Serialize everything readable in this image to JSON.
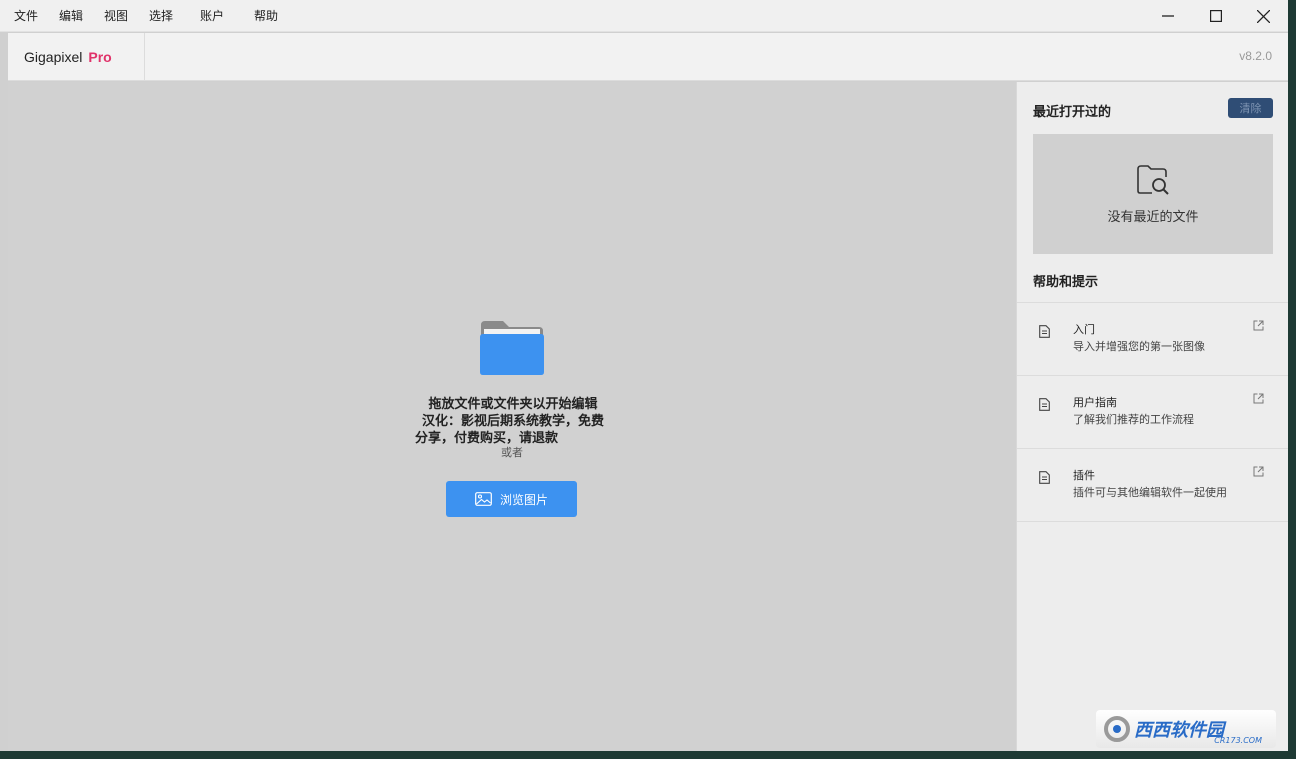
{
  "menu": {
    "items": [
      "文件",
      "编辑",
      "视图",
      "选择",
      "账户",
      "帮助"
    ]
  },
  "header": {
    "app_name": "Gigapixel",
    "app_edition": "Pro",
    "version": "v8.2.0"
  },
  "main": {
    "drop_line1": "拖放文件或文件夹以开始编辑",
    "drop_line2": "汉化：影视后期系统教学，免费",
    "drop_line3": "分享，付费购买，请退款",
    "or": "或者",
    "browse_label": "浏览图片"
  },
  "recent": {
    "title": "最近打开过的",
    "clear_label": "清除",
    "empty_text": "没有最近的文件"
  },
  "help": {
    "title": "帮助和提示",
    "items": [
      {
        "title": "入门",
        "desc": "导入并增强您的第一张图像"
      },
      {
        "title": "用户指南",
        "desc": "了解我们推荐的工作流程"
      },
      {
        "title": "插件",
        "desc": "插件可与其他编辑软件一起使用"
      }
    ]
  },
  "watermark": {
    "text": "西西软件园",
    "sub": "CR173.COM"
  },
  "colors": {
    "accent": "#3d92f0",
    "brand_pro": "#e0336a",
    "clear_button": "#2f4d75"
  },
  "icons": {
    "minimize": "minimize-icon",
    "maximize": "maximize-icon",
    "close": "close-icon",
    "folder": "folder-icon",
    "image": "image-icon",
    "folder_search": "folder-search-icon",
    "document": "document-icon",
    "external_link": "external-link-icon"
  }
}
